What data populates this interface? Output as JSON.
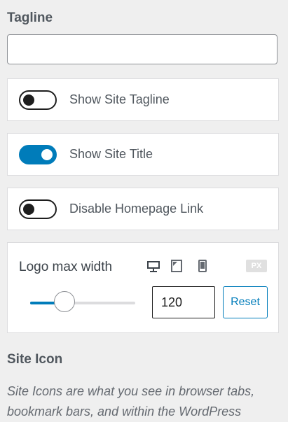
{
  "tagline": {
    "label": "Tagline",
    "value": "",
    "placeholder": ""
  },
  "toggles": [
    {
      "label": "Show Site Tagline",
      "on": false
    },
    {
      "label": "Show Site Title",
      "on": true
    },
    {
      "label": "Disable Homepage Link",
      "on": false
    }
  ],
  "logo_width": {
    "title": "Logo max width",
    "devices": [
      "desktop-icon",
      "tablet-icon",
      "mobile-icon"
    ],
    "unit": "PX",
    "value": "120",
    "slider_fraction": 0.33,
    "reset_label": "Reset"
  },
  "site_icon": {
    "label": "Site Icon",
    "description": "Site Icons are what you see in browser tabs, bookmark bars, and within the WordPress"
  },
  "colors": {
    "accent": "#007cba",
    "toggle_off": "#1e1e1e",
    "background": "#efefef"
  }
}
